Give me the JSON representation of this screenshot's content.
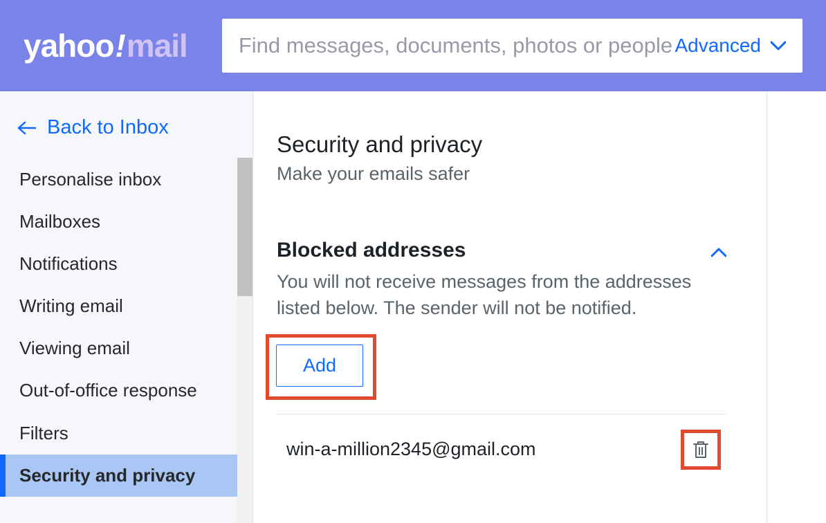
{
  "header": {
    "logo_yahoo": "yahoo",
    "logo_excl": "!",
    "logo_mail": "mail",
    "search_placeholder": "Find messages, documents, photos or people",
    "advanced_label": "Advanced"
  },
  "sidebar": {
    "back_label": "Back to Inbox",
    "items": [
      {
        "label": "Personalise inbox",
        "active": false
      },
      {
        "label": "Mailboxes",
        "active": false
      },
      {
        "label": "Notifications",
        "active": false
      },
      {
        "label": "Writing email",
        "active": false
      },
      {
        "label": "Viewing email",
        "active": false
      },
      {
        "label": "Out-of-office response",
        "active": false
      },
      {
        "label": "Filters",
        "active": false
      },
      {
        "label": "Security and privacy",
        "active": true
      }
    ]
  },
  "main": {
    "title": "Security and privacy",
    "subtitle": "Make your emails safer",
    "blocked": {
      "heading": "Blocked addresses",
      "description": "You will not receive messages from the addresses listed below. The sender will not be notified.",
      "add_label": "Add",
      "entries": [
        {
          "email": "win-a-million2345@gmail.com"
        }
      ]
    }
  }
}
